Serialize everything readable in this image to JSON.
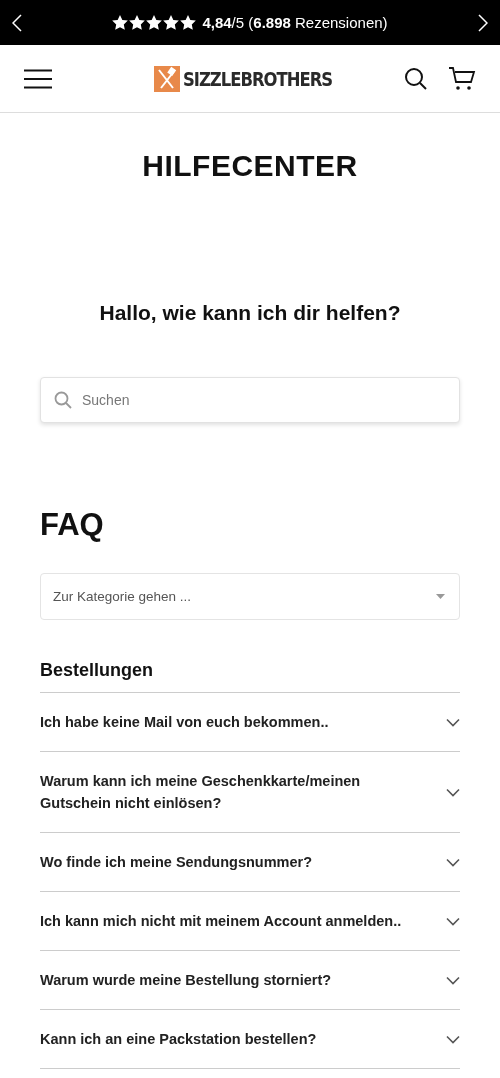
{
  "announcement": {
    "stars": 5,
    "rating": "**4,84**/5 (**6.898** Rezensionen)"
  },
  "header": {
    "logo": "SIZZLEBROTHERS"
  },
  "page_title": "HILFECENTER",
  "greeting": "Hallo, wie kann ich dir helfen?",
  "search": {
    "placeholder": "Suchen"
  },
  "faq": {
    "title": "FAQ",
    "category_select": {
      "placeholder": "Zur Kategorie gehen ..."
    },
    "section": "Bestellungen",
    "questions": [
      {
        "text": "Ich habe keine Mail von euch bekommen..",
        "expanded": false
      },
      {
        "text": "Warum kann ich meine Geschenkkarte/meinen Gutschein nicht einlösen?",
        "expanded": false
      },
      {
        "text": "Wo finde ich meine Sendungsnummer?",
        "expanded": false
      },
      {
        "text": "Ich kann mich nicht mit meinem Account anmelden..",
        "expanded": false
      },
      {
        "text": "Warum wurde meine Bestellung storniert?",
        "expanded": false
      },
      {
        "text": "Kann ich an eine Packstation bestellen?",
        "expanded": false
      }
    ]
  }
}
